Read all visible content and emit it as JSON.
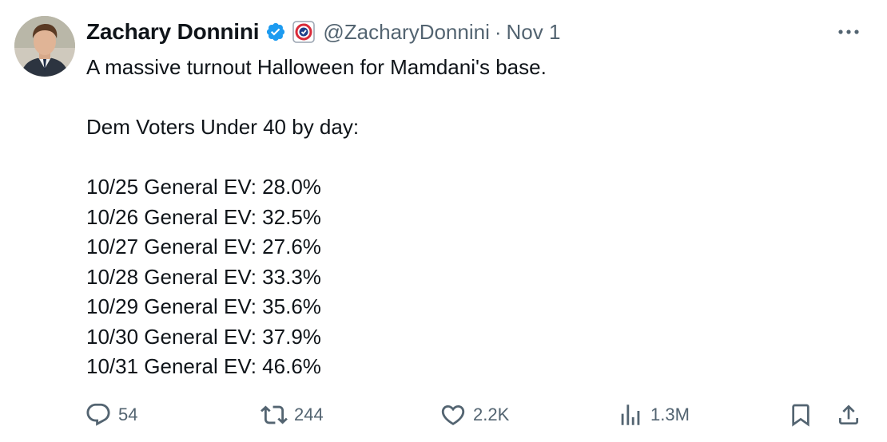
{
  "author": {
    "name": "Zachary Donnini",
    "handle": "@ZacharyDonnini",
    "separator": "·",
    "date": "Nov 1"
  },
  "tweet": {
    "headline": "A massive turnout Halloween for Mamdani's base.",
    "subheading": "Dem Voters Under 40 by day:",
    "lines": [
      "10/25 General EV:  28.0%",
      "10/26 General EV:  32.5%",
      "10/27 General EV:  27.6%",
      "10/28 General EV:  33.3%",
      "10/29 General EV:  35.6%",
      "10/30 General EV:  37.9%",
      "10/31 General EV:  46.6%"
    ]
  },
  "actions": {
    "replies": "54",
    "reposts": "244",
    "likes": "2.2K",
    "views": "1.3M"
  },
  "icons": {
    "verified": "verified-badge-icon",
    "affiliation": "affiliation-badge-icon",
    "more": "more-options-icon",
    "reply": "reply-icon",
    "repost": "repost-icon",
    "like": "heart-icon",
    "views": "views-icon",
    "bookmark": "bookmark-icon",
    "share": "share-icon"
  },
  "colors": {
    "text": "#0f1419",
    "secondary": "#536471",
    "verified_blue": "#1d9bf0"
  }
}
